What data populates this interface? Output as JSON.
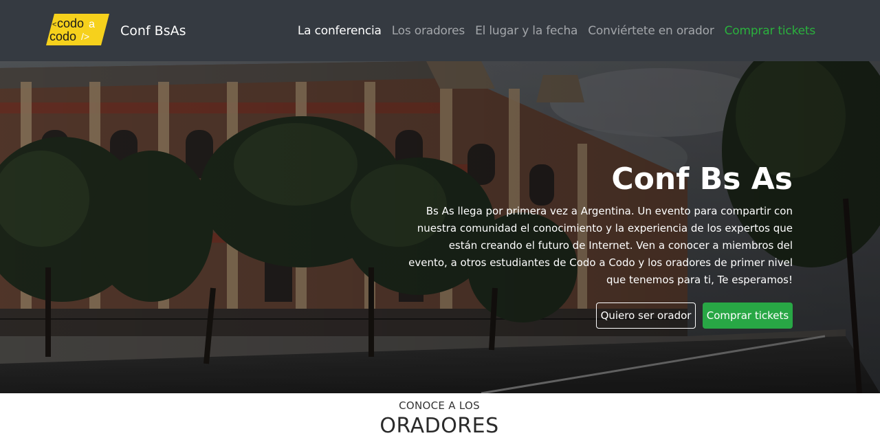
{
  "navbar": {
    "logo": {
      "line1_prefix": "<",
      "line1_word": "codo",
      "line1_suffix": "a",
      "line2_word": "codo",
      "line2_suffix": "/>"
    },
    "brand_name": "Conf BsAs",
    "links": [
      {
        "label": "La conferencia",
        "state": "active"
      },
      {
        "label": "Los oradores",
        "state": "normal"
      },
      {
        "label": "El lugar y la fecha",
        "state": "normal"
      },
      {
        "label": "Conviértete en orador",
        "state": "normal"
      },
      {
        "label": "Comprar tickets",
        "state": "highlight"
      }
    ]
  },
  "hero": {
    "title": "Conf Bs As",
    "description": "Bs As llega por primera vez a Argentina. Un evento para compartir con nuestra comunidad el conocimiento y la experiencia de los expertos que están creando el futuro de Internet. Ven a conocer a miembros del evento, a otros estudiantes de Codo a Codo y los oradores de primer nivel que tenemos para ti, Te esperamos!",
    "buttons": {
      "speaker": "Quiero ser orador",
      "tickets": "Comprar tickets"
    }
  },
  "speakers_section": {
    "subtitle": "CONOCE A LOS",
    "title": "ORADORES"
  },
  "colors": {
    "navbar_bg": "#353a41",
    "accent_green": "#28a745",
    "logo_yellow": "#f6d11c"
  }
}
